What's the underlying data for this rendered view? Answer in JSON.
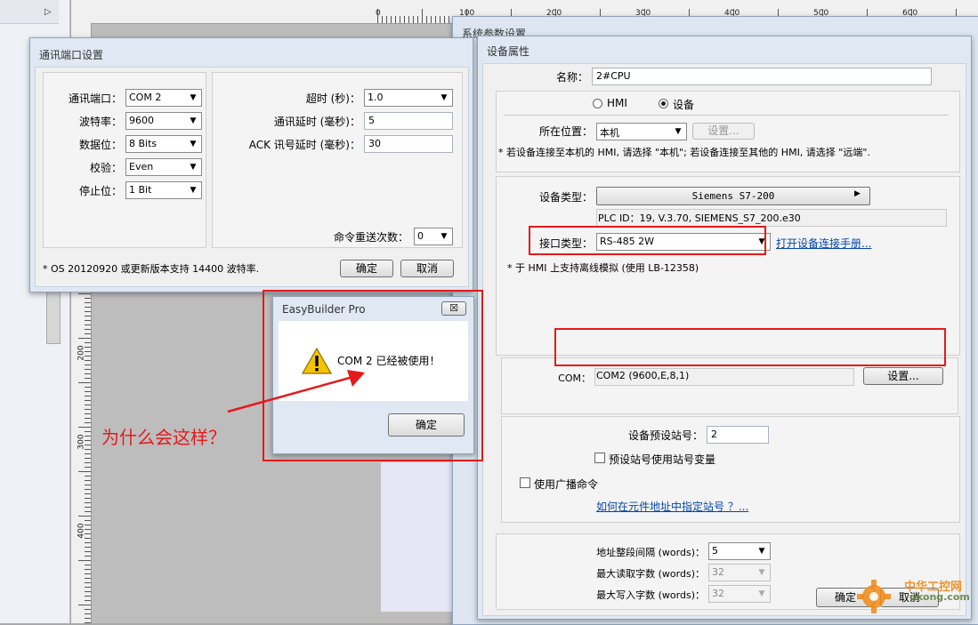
{
  "background": {
    "ruler_top_numbers": [
      "0",
      "100",
      "200",
      "300",
      "400",
      "500",
      "600"
    ],
    "ruler_left_numbers": [
      "200",
      "300",
      "400"
    ],
    "sys_param_title": "系统参数设置",
    "collapse_glyph": "▷"
  },
  "comm_port_dialog": {
    "title": "通讯端口设置",
    "port_label": "通讯端口：",
    "port_value": "COM 2",
    "baud_label": "波特率：",
    "baud_value": "9600",
    "databits_label": "数据位：",
    "databits_value": "8 Bits",
    "parity_label": "校验：",
    "parity_value": "Even",
    "stopbits_label": "停止位：",
    "stopbits_value": "1 Bit",
    "timeout_label": "超时 (秒)：",
    "timeout_value": "1.0",
    "comm_delay_label": "通讯延时 (毫秒)：",
    "comm_delay_value": "5",
    "ack_delay_label": "ACK 讯号延时 (毫秒)：",
    "ack_delay_value": "30",
    "retry_label": "命令重送次数：",
    "retry_value": "0",
    "note": "* OS 20120920 或更新版本支持 14400 波特率.",
    "ok_label": "确定",
    "cancel_label": "取消"
  },
  "device_dialog": {
    "title": "设备属性",
    "name_label": "名称：",
    "name_value": "2#CPU",
    "radio_hmi": "HMI",
    "radio_device": "设备",
    "location_label": "所在位置：",
    "location_value": "本机",
    "location_settings": "设置...",
    "location_note": "* 若设备连接至本机的 HMI, 请选择 \"本机\"; 若设备连接至其他的 HMI, 请选择 \"远端\".",
    "device_type_label": "设备类型：",
    "device_type_value": "Siemens S7-200",
    "plc_id": "PLC ID：19, V.3.70, SIEMENS_S7_200.e30",
    "interface_label": "接口类型：",
    "interface_value": "RS-485 2W",
    "manual_link": "打开设备连接手册...",
    "offline_note": "* 于 HMI 上支持离线模拟 (使用 LB-12358)",
    "com_label": "COM：",
    "com_value": "COM2 (9600,E,8,1)",
    "com_settings": "设置...",
    "station_label": "设备预设站号：",
    "station_value": "2",
    "station_var_label": "预设站号使用站号变量",
    "broadcast_label": "使用广播命令",
    "station_link": "如何在元件地址中指定站号 ？...",
    "addr_interval_label": "地址整段间隔 (words)：",
    "addr_interval_value": "5",
    "max_read_label": "最大读取字数 (words)：",
    "max_read_value": "32",
    "max_write_label": "最大写入字数 (words)：",
    "max_write_value": "32",
    "ok_label": "确定",
    "cancel_label": "取消"
  },
  "alert": {
    "title": "EasyBuilder Pro",
    "close_glyph": "☒",
    "message": "COM 2 已经被使用！",
    "ok_label": "确定"
  },
  "annotation": {
    "question": "为什么会这样？",
    "color": "#e41a1a"
  },
  "watermark": {
    "line1": "中华工控网",
    "line2": "gkong.com"
  }
}
